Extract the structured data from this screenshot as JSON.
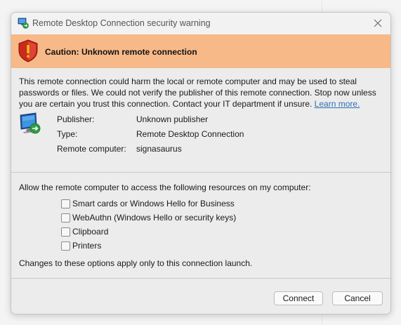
{
  "dialog": {
    "title": "Remote Desktop Connection security warning",
    "icons": {
      "app": "remote-desktop-icon",
      "close": "close-icon",
      "warning": "shield-warning-icon",
      "publisher": "remote-desktop-monitor-icon"
    }
  },
  "banner": {
    "text": "Caution: Unknown remote connection",
    "color": "#f7b988"
  },
  "warning": {
    "text": "This remote connection could harm the local or remote computer and may be used to steal passwords or files. We could not verify the publisher of this remote connection. Stop now unless you are certain you trust this connection. Contact your IT department if unsure.",
    "link_label": "Learn more."
  },
  "info": {
    "publisher_label": "Publisher:",
    "publisher_value": "Unknown publisher",
    "type_label": "Type:",
    "type_value": "Remote Desktop Connection",
    "computer_label": "Remote computer:",
    "computer_value": "signasaurus"
  },
  "resources": {
    "heading": "Allow the remote computer to access the following resources on my computer:",
    "items": [
      {
        "label": "Smart cards or Windows Hello for Business",
        "checked": false
      },
      {
        "label": "WebAuthn (Windows Hello or security keys)",
        "checked": false
      },
      {
        "label": "Clipboard",
        "checked": false
      },
      {
        "label": "Printers",
        "checked": false
      }
    ],
    "note": "Changes to these options apply only to this connection launch."
  },
  "buttons": {
    "connect": "Connect",
    "cancel": "Cancel"
  }
}
